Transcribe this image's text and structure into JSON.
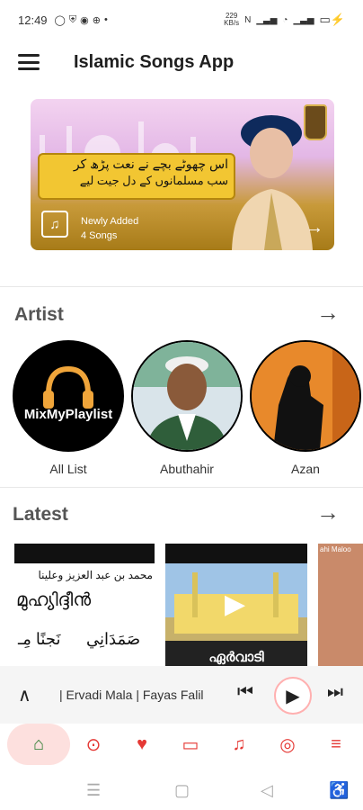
{
  "status": {
    "time": "12:49",
    "net_speed": "229\nKB/s",
    "battery": "▭"
  },
  "app": {
    "title": "Islamic Songs App"
  },
  "banner": {
    "tag": "Newly Added",
    "count": "4 Songs",
    "urdu_lines": [
      "اس چھوٹے بچے نے نعت پڑھ کر",
      "سب مسلمانوں کے دل جیت لیے"
    ]
  },
  "artist_section": {
    "title": "Artist"
  },
  "artists": [
    {
      "name": "All List",
      "logo_text": "MixMyPlaylist"
    },
    {
      "name": "Abuthahir"
    },
    {
      "name": "Azan"
    }
  ],
  "latest_section": {
    "title": "Latest"
  },
  "latest_tiles": [
    {
      "text1": "محمد بن عبد العزيز وعلينا",
      "text2": "മുഹ്യിദ്ദീൻ",
      "text3": "نَجنًا مِـ",
      "text4": "صَمَدَانِي"
    },
    {
      "text": "ഏർവാടി"
    },
    {
      "text": "ahi Maloo"
    }
  ],
  "player": {
    "now_playing": "| Ervadi Mala | Fayas Falil"
  },
  "colors": {
    "accent": "#e53935",
    "home_green": "#2e7d32",
    "home_pill": "#fde0de"
  }
}
